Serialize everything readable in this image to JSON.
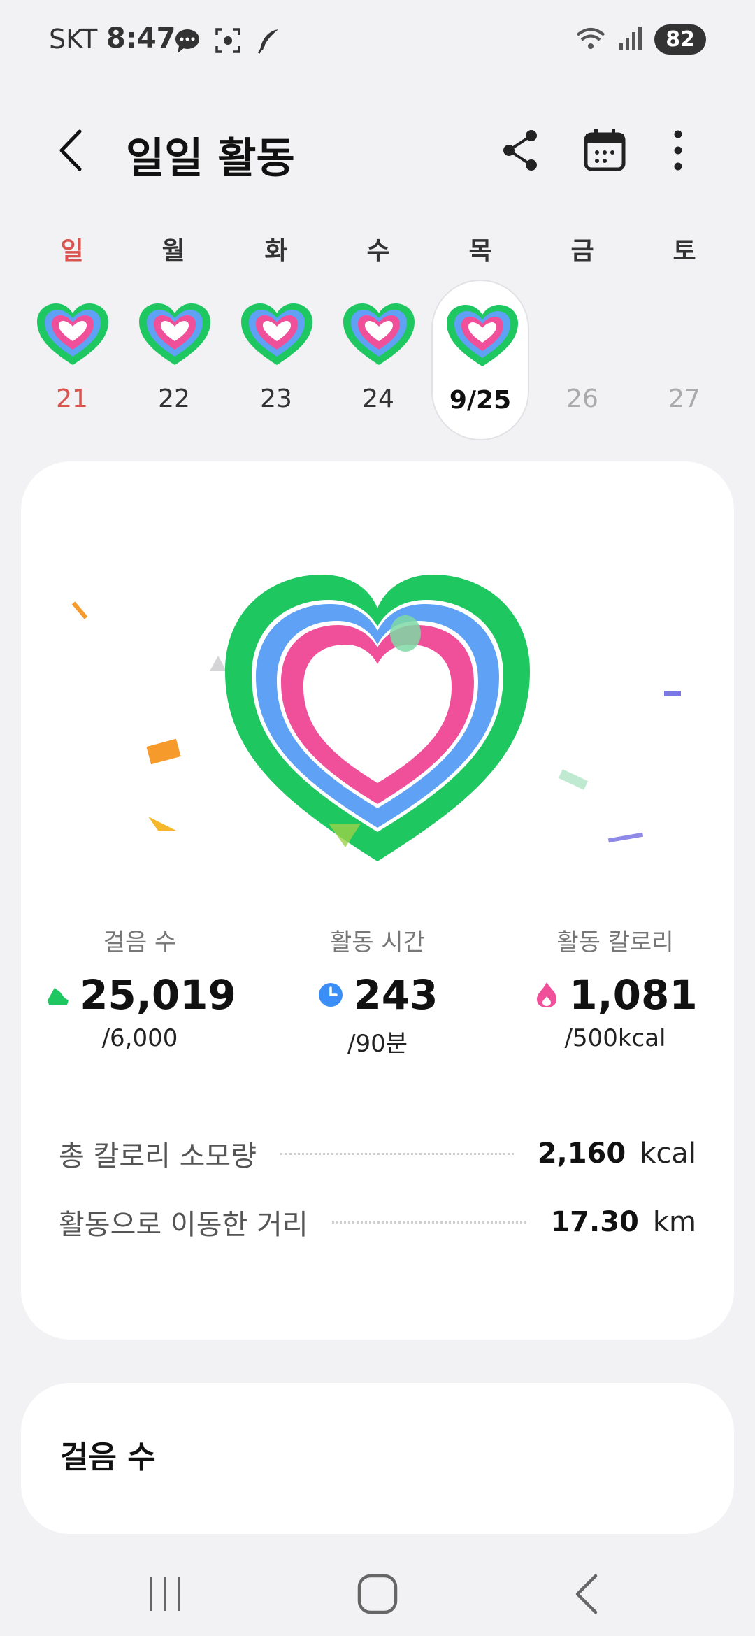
{
  "status_bar": {
    "carrier": "SKT",
    "time": "8:47",
    "battery": "82",
    "icons": [
      "chat-icon",
      "screenshot-icon",
      "feather-icon",
      "wifi-icon",
      "signal-icon"
    ]
  },
  "header": {
    "title": "일일 활동",
    "actions": [
      "share-icon",
      "calendar-icon",
      "more-icon"
    ]
  },
  "week": {
    "weekdays": [
      "일",
      "월",
      "화",
      "수",
      "목",
      "금",
      "토"
    ],
    "days": [
      {
        "label": "21",
        "has_activity": true,
        "state": "sunday"
      },
      {
        "label": "22",
        "has_activity": true,
        "state": "past"
      },
      {
        "label": "23",
        "has_activity": true,
        "state": "past"
      },
      {
        "label": "24",
        "has_activity": true,
        "state": "past"
      },
      {
        "label": "9/25",
        "has_activity": true,
        "state": "selected"
      },
      {
        "label": "26",
        "has_activity": false,
        "state": "future"
      },
      {
        "label": "27",
        "has_activity": false,
        "state": "future"
      }
    ]
  },
  "summary": {
    "stats": [
      {
        "label": "걸음 수",
        "value": "25,019",
        "goal": "/6,000",
        "icon": "shoe-icon",
        "color": "#1ec760"
      },
      {
        "label": "활동 시간",
        "value": "243",
        "goal": "/90분",
        "icon": "clock-icon",
        "color": "#3a8ef6"
      },
      {
        "label": "활동 칼로리",
        "value": "1,081",
        "goal": "/500kcal",
        "icon": "flame-icon",
        "color": "#f0509a"
      }
    ],
    "details": [
      {
        "label": "총 칼로리 소모량",
        "value": "2,160",
        "unit": "kcal"
      },
      {
        "label": "활동으로 이동한 거리",
        "value": "17.30",
        "unit": "km"
      }
    ],
    "rings": {
      "outer": "#1ec760",
      "middle": "#5fa2f5",
      "inner": "#f0509a"
    }
  },
  "steps_card": {
    "title": "걸음 수"
  }
}
